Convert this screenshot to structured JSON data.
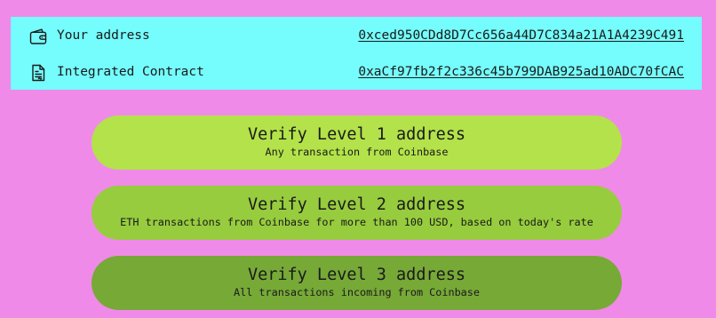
{
  "info_panel": {
    "wallet": {
      "icon": "wallet-icon",
      "label": "Your address",
      "value": "0xced950CDd8D7Cc656a44D7C834a21A1A4239C491"
    },
    "contract": {
      "icon": "contract-document-icon",
      "label": "Integrated Contract",
      "value": "0xaCf97fb2f2c336c45b799DAB925ad10ADC70fCAC"
    },
    "background_color": "#75fcfc"
  },
  "verify_levels": [
    {
      "title": "Verify Level 1 address",
      "subtitle": "Any transaction from Coinbase",
      "color": "#b3e24a"
    },
    {
      "title": "Verify Level 2 address",
      "subtitle": "ETH transactions from Coinbase for more than 100 USD, based on today's rate",
      "color": "#97cc3e"
    },
    {
      "title": "Verify Level 3 address",
      "subtitle": "All transactions incoming from Coinbase",
      "color": "#77a937"
    }
  ],
  "page_background": "#f08ae8"
}
